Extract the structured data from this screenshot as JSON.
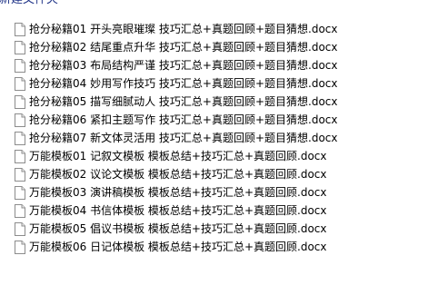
{
  "folder": {
    "name": "新建文件夹"
  },
  "files": [
    {
      "name": "抢分秘籍01 开头亮眼璀璨 技巧汇总+真题回顾+题目猜想.docx",
      "icon": "document-icon"
    },
    {
      "name": "抢分秘籍02 结尾重点升华 技巧汇总+真题回顾+题目猜想.docx",
      "icon": "document-icon"
    },
    {
      "name": "抢分秘籍03 布局结构严谨 技巧汇总+真题回顾+题目猜想.docx",
      "icon": "document-icon"
    },
    {
      "name": "抢分秘籍04 妙用写作技巧 技巧汇总+真题回顾+题目猜想.docx",
      "icon": "document-icon"
    },
    {
      "name": "抢分秘籍05 描写细腻动人 技巧汇总+真题回顾+题目猜想.docx",
      "icon": "document-icon"
    },
    {
      "name": "抢分秘籍06 紧扣主题写作 技巧汇总+真题回顾+题目猜想.docx",
      "icon": "document-icon"
    },
    {
      "name": "抢分秘籍07 新文体灵活用 技巧汇总+真题回顾+题目猜想.docx",
      "icon": "document-icon"
    },
    {
      "name": "万能模板01 记叙文模板 模板总结+技巧汇总+真题回顾.docx",
      "icon": "document-icon"
    },
    {
      "name": "万能模板02 议论文模板 模板总结+技巧汇总+真题回顾.docx",
      "icon": "document-icon"
    },
    {
      "name": "万能模板03 演讲稿模板 模板总结+技巧汇总+真题回顾.docx",
      "icon": "document-icon"
    },
    {
      "name": "万能模板04 书信体模板 模板总结+技巧汇总+真题回顾.docx",
      "icon": "document-icon"
    },
    {
      "name": "万能模板05 倡议书模板 模板总结+技巧汇总+真题回顾.docx",
      "icon": "document-icon"
    },
    {
      "name": "万能模板06 日记体模板 模板总结+技巧汇总+真题回顾.docx",
      "icon": "document-icon"
    }
  ]
}
